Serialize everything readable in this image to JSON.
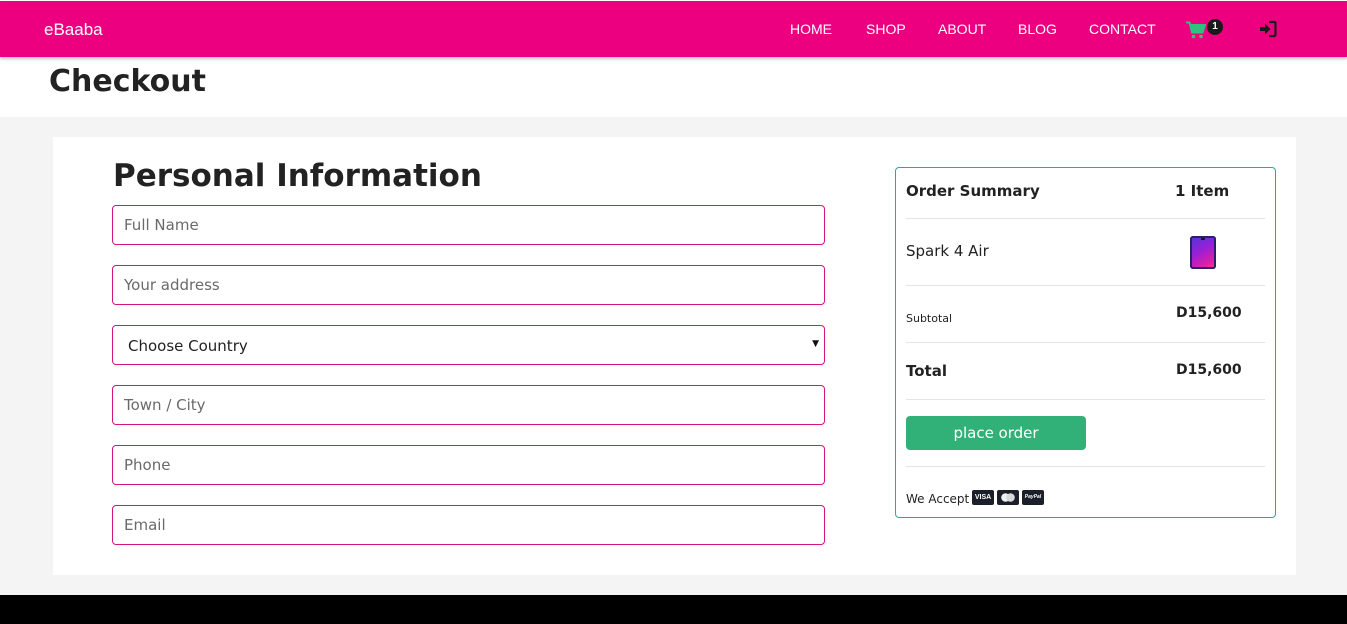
{
  "nav": {
    "brand": "eBaaba",
    "links": [
      "HOME",
      "SHOP",
      "ABOUT",
      "BLOG",
      "CONTACT"
    ],
    "cart_count": "1",
    "cart_icon": "shopping-cart-icon",
    "login_icon": "sign-in-icon"
  },
  "page": {
    "title": "Checkout"
  },
  "form": {
    "title": "Personal Information",
    "full_name_placeholder": "Full Name",
    "address_placeholder": "Your address",
    "country_selected": "Choose Country",
    "town_placeholder": "Town / City",
    "phone_placeholder": "Phone",
    "email_placeholder": "Email"
  },
  "summary": {
    "title": "Order Summary",
    "item_count": "1 Item",
    "product_name": "Spark 4 Air",
    "subtotal_label": "Subtotal",
    "subtotal_value": "D15,600",
    "total_label": "Total",
    "total_value": "D15,600",
    "place_order": "place order",
    "we_accept": "We Accept :",
    "payment_methods": [
      "VISA",
      "",
      "PayPal"
    ]
  },
  "colors": {
    "brand_pink": "#ec007f",
    "field_border": "#d6137f",
    "summary_border": "#2fa79a",
    "button_green": "#31b077",
    "cart_green": "#2ec27e"
  }
}
